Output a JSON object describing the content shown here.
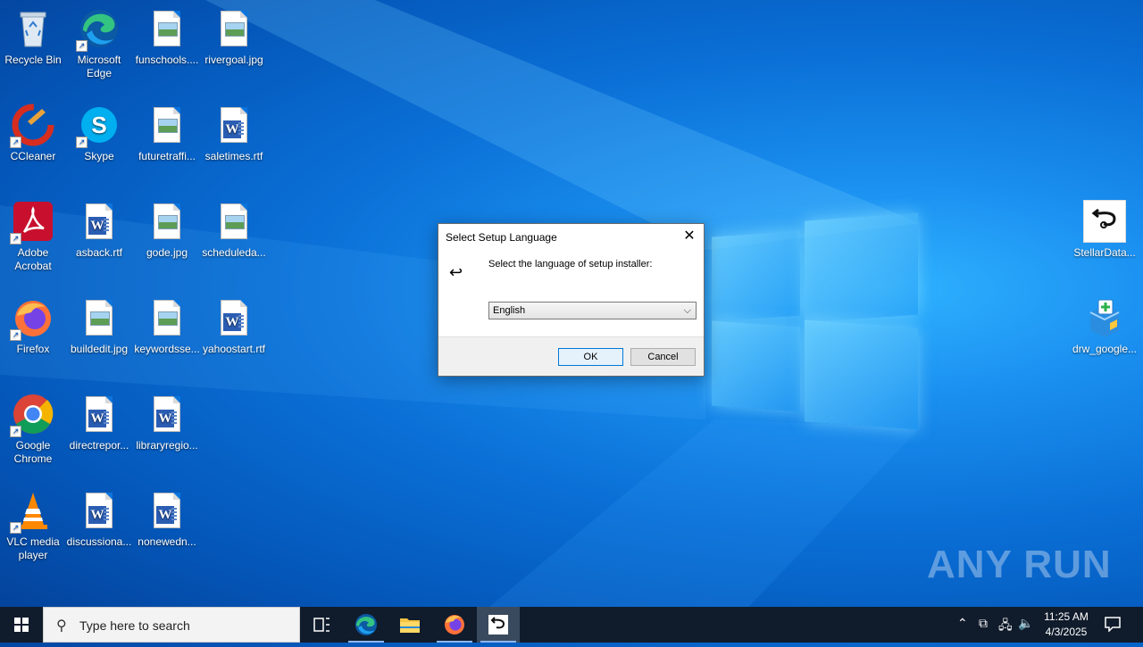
{
  "desktop": {
    "icons": [
      {
        "label": "Recycle Bin"
      },
      {
        "label": "Microsoft Edge"
      },
      {
        "label": "funschools...."
      },
      {
        "label": "rivergoal.jpg"
      },
      {
        "label": "CCleaner"
      },
      {
        "label": "Skype"
      },
      {
        "label": "futuretraffi..."
      },
      {
        "label": "saletimes.rtf"
      },
      {
        "label": "Adobe Acrobat"
      },
      {
        "label": "asback.rtf"
      },
      {
        "label": "gode.jpg"
      },
      {
        "label": "scheduleda..."
      },
      {
        "label": "Firefox"
      },
      {
        "label": "buildedit.jpg"
      },
      {
        "label": "keywordsse..."
      },
      {
        "label": "yahoostart.rtf"
      },
      {
        "label": "Google Chrome"
      },
      {
        "label": "directrepor..."
      },
      {
        "label": "libraryregio..."
      },
      {
        "label": "VLC media player"
      },
      {
        "label": "discussiona..."
      },
      {
        "label": "nonewedn..."
      },
      {
        "label": "StellarData..."
      },
      {
        "label": "drw_google..."
      }
    ]
  },
  "dialog": {
    "title": "Select Setup Language",
    "close_glyph": "✕",
    "icon_glyph": "↩",
    "prompt": "Select the language of setup installer:",
    "selected_language": "English",
    "ok_label": "OK",
    "cancel_label": "Cancel"
  },
  "taskbar": {
    "search_placeholder": "Type here to search",
    "clock_time": "11:25 AM",
    "clock_date": "4/3/2025",
    "apps": [
      "task-view",
      "microsoft-edge",
      "file-explorer",
      "firefox",
      "setup-language"
    ]
  },
  "watermark": "ANY RUN"
}
